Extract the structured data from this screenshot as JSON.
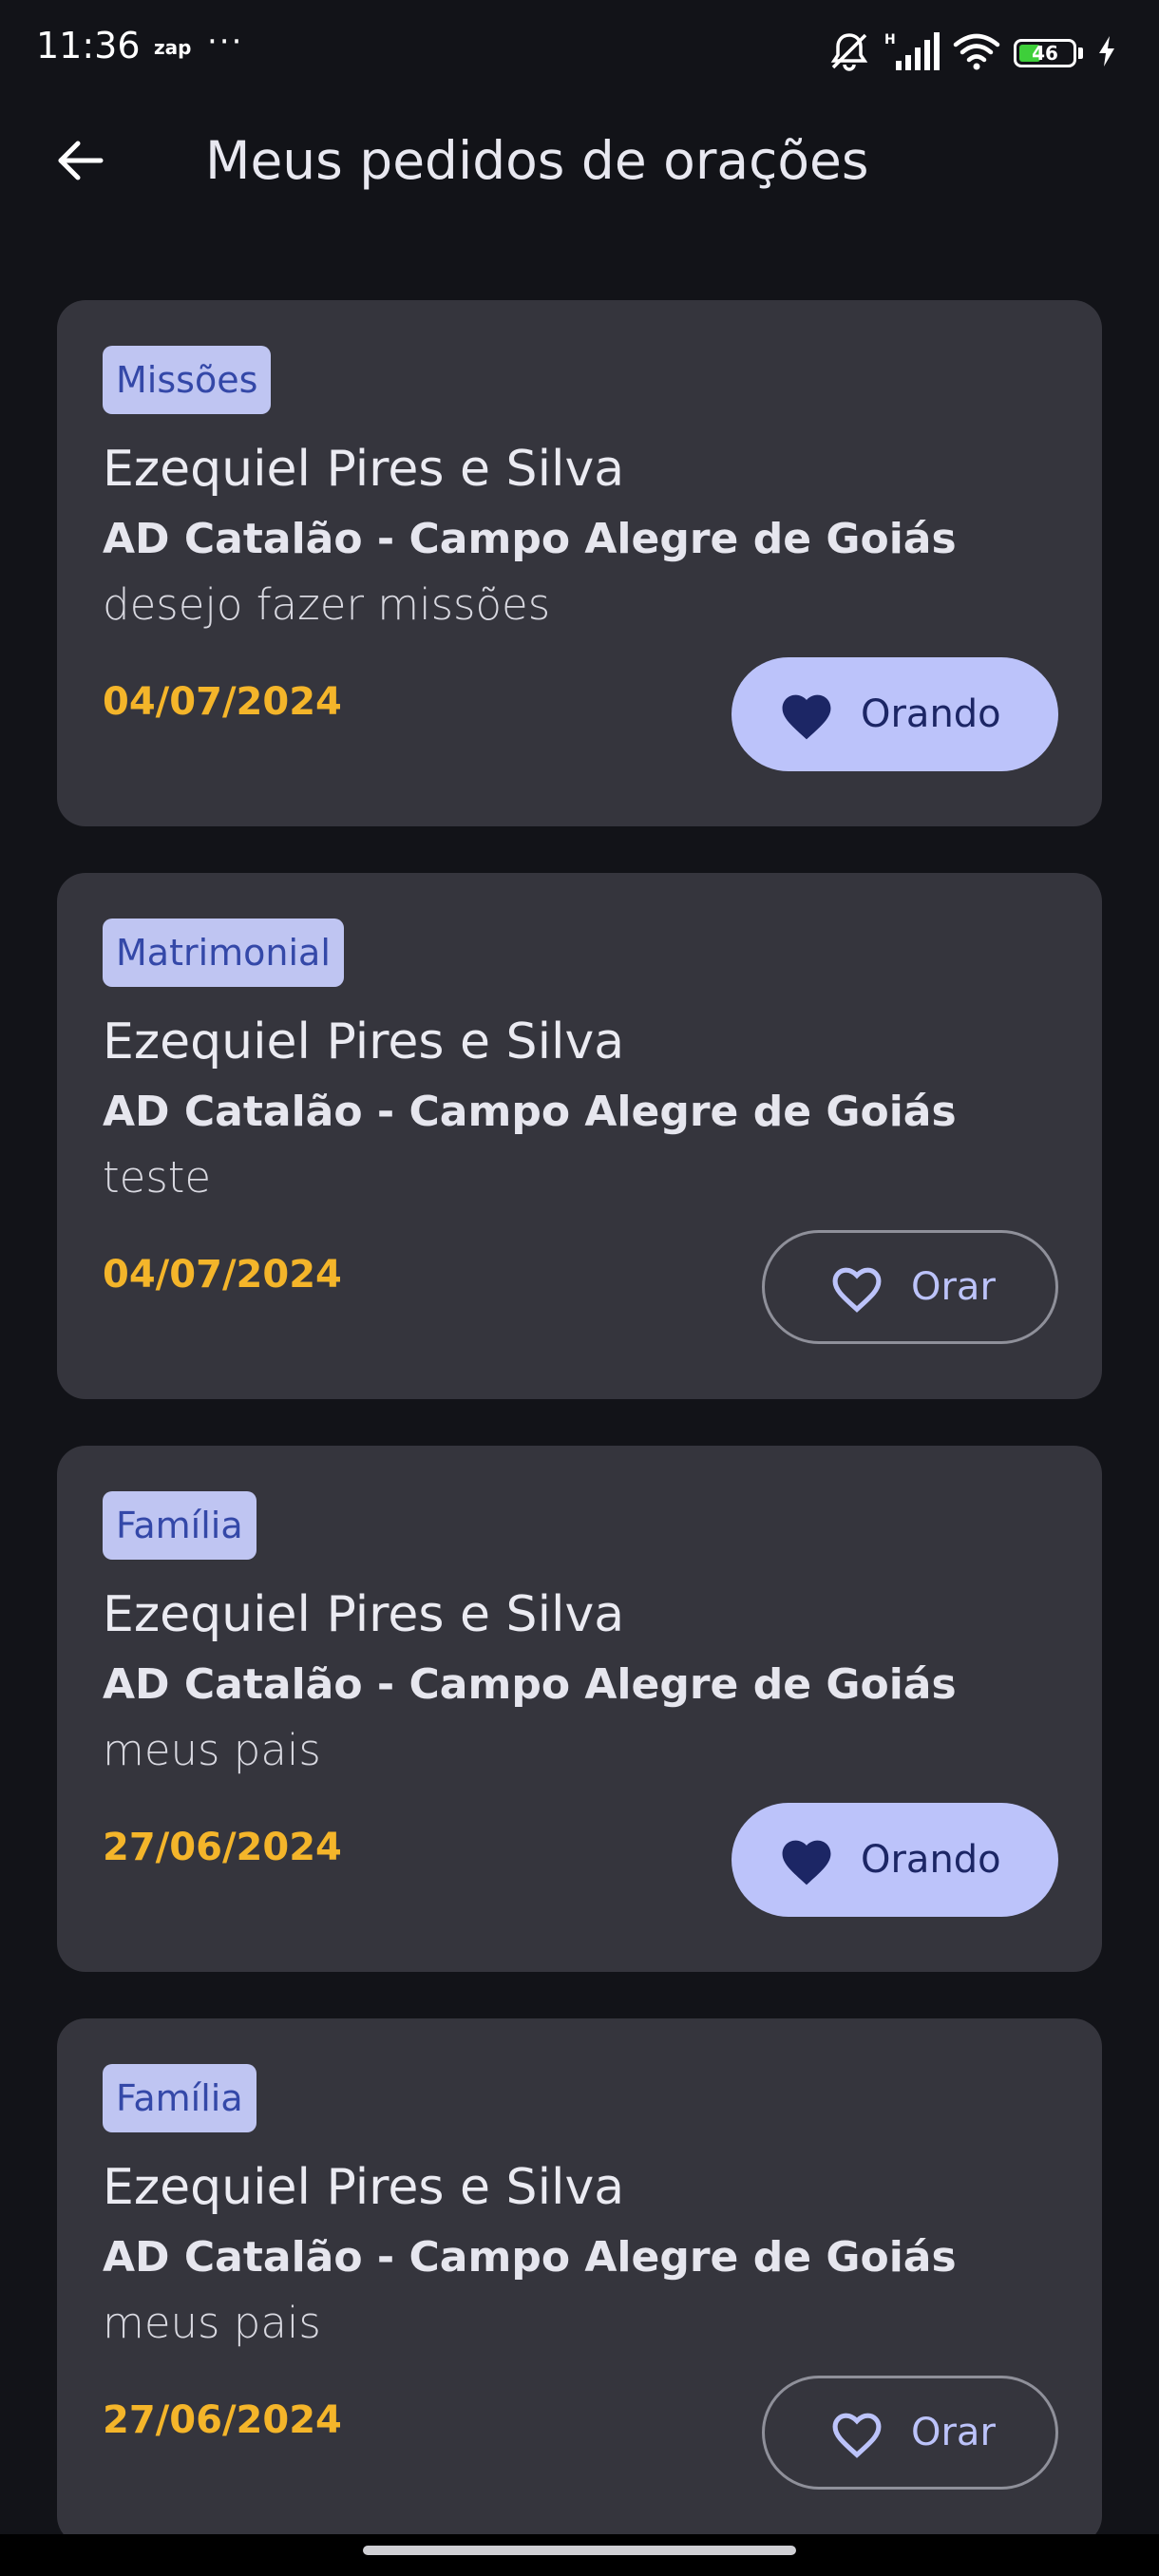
{
  "status_bar": {
    "time": "11:36",
    "app_label": "zap",
    "overflow": "···",
    "battery_level": "46",
    "icons": [
      "mute-icon",
      "signal-icon",
      "wifi-icon",
      "battery-icon",
      "charging-icon"
    ]
  },
  "header": {
    "back_icon": "arrow-left-icon",
    "title": "Meus pedidos de orações"
  },
  "requests": [
    {
      "category": "Missões",
      "name": "Ezequiel Pires e Silva",
      "church": "AD Catalão - Campo Alegre de Goiás",
      "message": "desejo fazer missões",
      "date": "04/07/2024",
      "button_label": "Orando",
      "praying": true
    },
    {
      "category": "Matrimonial",
      "name": "Ezequiel Pires e Silva",
      "church": "AD Catalão - Campo Alegre de Goiás",
      "message": "teste",
      "date": "04/07/2024",
      "button_label": "Orar",
      "praying": false
    },
    {
      "category": "Família",
      "name": "Ezequiel Pires e Silva",
      "church": "AD Catalão - Campo Alegre de Goiás",
      "message": "meus pais",
      "date": "27/06/2024",
      "button_label": "Orando",
      "praying": true
    },
    {
      "category": "Família",
      "name": "Ezequiel Pires e Silva",
      "church": "AD Catalão - Campo Alegre de Goiás",
      "message": "meus pais",
      "date": "27/06/2024",
      "button_label": "Orar",
      "praying": false
    }
  ],
  "colors": {
    "background": "#121318",
    "card": "#35353d",
    "chip_bg": "#bfc5f2",
    "chip_text": "#3448a8",
    "date": "#f4b52a",
    "button_filled": "#bcc3fa",
    "button_filled_text": "#1c2665",
    "button_outline_text": "#bcc3fa"
  }
}
